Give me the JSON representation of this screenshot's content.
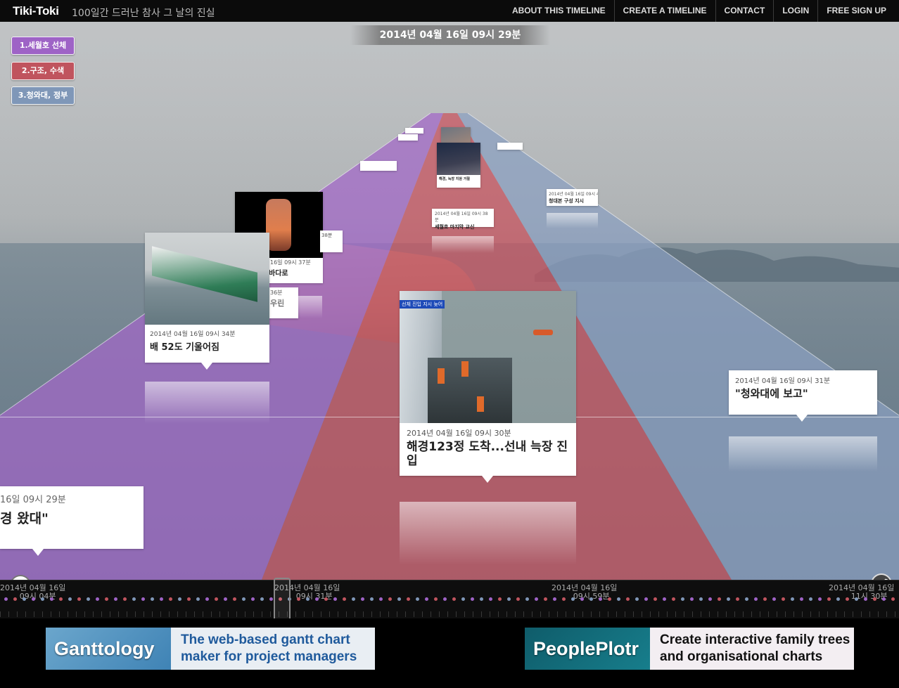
{
  "header": {
    "brand": "Tiki-Toki",
    "subtitle": "100일간 드러난 참사 그 날의 진실",
    "nav": [
      "ABOUT THIS TIMELINE",
      "CREATE A TIMELINE",
      "CONTACT",
      "LOGIN",
      "FREE SIGN UP"
    ]
  },
  "current_date": "2014년 04월 16일 09시 29분",
  "categories": [
    {
      "label": "1.세월호 선체",
      "color": "#9e63c6"
    },
    {
      "label": "2.구조, 수색",
      "color": "#c0545e"
    },
    {
      "label": "3.청와대, 정부",
      "color": "#7f97b8"
    }
  ],
  "cards": {
    "c930": {
      "date": "2014년 04월 16일 09시 30분",
      "title": "해경123정 도착...선내 늑장 진입",
      "photo_caption": "선체 진입 지시 늦어"
    },
    "c934": {
      "date": "2014년 04월 16일 09시 34분",
      "title": "배 52도 기울어짐"
    },
    "c931": {
      "date": "2014년 04월 16일 09시 31분",
      "title": "\"청와대에 보고\""
    },
    "left": {
      "date": "16일 09시 29분",
      "title": "경 왔대\""
    },
    "mid1": {
      "date": "16일 09시 37분",
      "title": "바다로"
    },
    "mid2": {
      "date": "36분",
      "title": "우린"
    },
    "mid3": {
      "date": "38분"
    },
    "far1": {
      "date": "2014년 04월 16일 09시 38분",
      "title": "세월호 마지막 교신"
    },
    "far2": {
      "date": "2014년 04월 16일 09시 4",
      "title": "청대본 구성 지시"
    },
    "far3": {
      "title": "해경, 늑장 지원 거절"
    }
  },
  "timeline": {
    "labels": [
      {
        "date": "2014년 04월 16일",
        "time": "09시 04분"
      },
      {
        "date": "2014년 04월 16일",
        "time": "09시 31분"
      },
      {
        "date": "2014년 04월 16일",
        "time": "09시 59분"
      },
      {
        "date": "2014년 04월 16일",
        "time": "11시 30분"
      }
    ]
  },
  "controls": {
    "view_2d": "2d"
  },
  "ads": [
    {
      "logo": "Ganttology",
      "line1": "The web-based gantt chart",
      "line2": "maker for project managers"
    },
    {
      "logo": "PeoplePlotr",
      "line1": "Create interactive family trees",
      "line2": "and organisational charts"
    }
  ]
}
